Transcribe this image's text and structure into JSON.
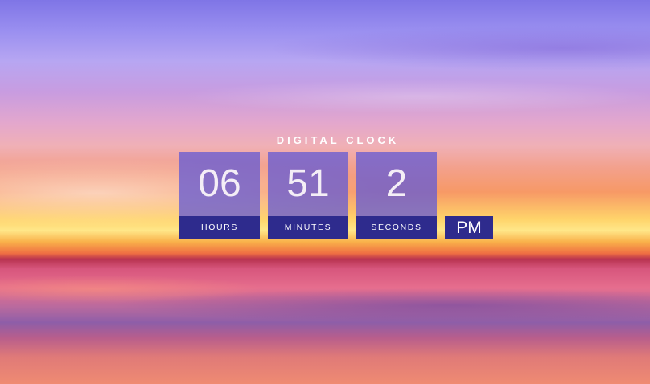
{
  "clock": {
    "title": "DIGITAL CLOCK",
    "hours": "06",
    "minutes": "51",
    "seconds": "2",
    "hours_label": "HOURS",
    "minutes_label": "MINUTES",
    "seconds_label": "SECONDS",
    "period": "PM"
  },
  "colors": {
    "tile": "#685cd2",
    "label_band": "#2e2b8d",
    "text": "#ffffff"
  }
}
